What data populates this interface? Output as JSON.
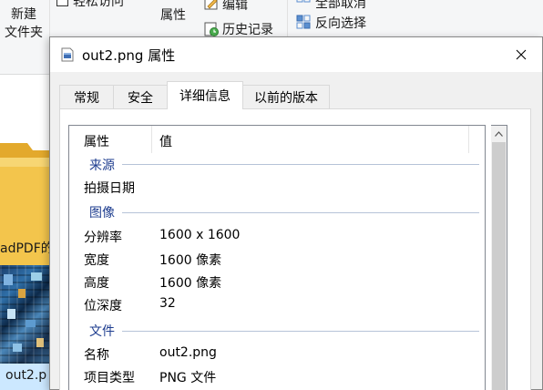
{
  "ribbon": {
    "new_folder_line1": "新建",
    "new_folder_line2": "文件夹",
    "easy_access": "轻松访问",
    "properties": "属性",
    "edit": "编辑",
    "history": "历史记录",
    "select_none": "全部取消",
    "invert_selection": "反向选择"
  },
  "explorer": {
    "file_label_pdf": "adPDF的",
    "file_label_png": "out2.p"
  },
  "dialog": {
    "title": "out2.png 属性",
    "close_icon": "close-icon",
    "tabs": [
      {
        "label": "常规",
        "active": false
      },
      {
        "label": "安全",
        "active": false
      },
      {
        "label": "详细信息",
        "active": true
      },
      {
        "label": "以前的版本",
        "active": false
      }
    ],
    "list": {
      "header": {
        "property": "属性",
        "value": "值"
      },
      "groups": [
        {
          "title": "来源",
          "rows": [
            {
              "name": "拍摄日期",
              "value": ""
            }
          ]
        },
        {
          "title": "图像",
          "rows": [
            {
              "name": "分辨率",
              "value": "1600 x 1600"
            },
            {
              "name": "宽度",
              "value": "1600 像素"
            },
            {
              "name": "高度",
              "value": "1600 像素"
            },
            {
              "name": "位深度",
              "value": "32"
            }
          ]
        },
        {
          "title": "文件",
          "rows": [
            {
              "name": "名称",
              "value": "out2.png"
            },
            {
              "name": "项目类型",
              "value": "PNG 文件"
            }
          ]
        }
      ]
    }
  },
  "colors": {
    "group_title": "#1e3d8f",
    "selection": "#cce8ff",
    "folder": "#f3c54c"
  }
}
